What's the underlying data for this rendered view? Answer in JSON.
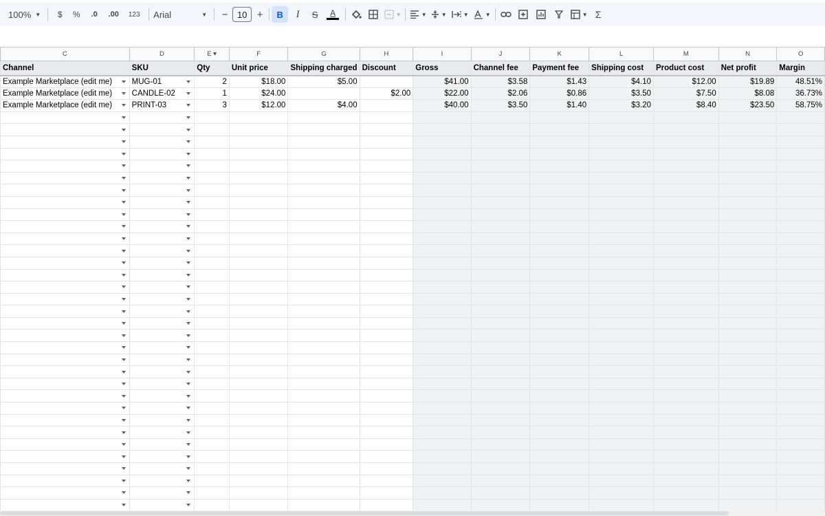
{
  "toolbar": {
    "zoom": "100%",
    "currency": "$",
    "percent": "%",
    "decrease_decimal": ".0",
    "increase_decimal": ".00",
    "number_format": "123",
    "font": "Arial",
    "minus": "−",
    "font_size": "10",
    "plus": "+",
    "bold": "B",
    "italic": "I",
    "strike": "S",
    "text_color": "A",
    "functions": "Σ"
  },
  "columns": [
    "C",
    "D",
    "E",
    "F",
    "G",
    "H",
    "I",
    "J",
    "K",
    "L",
    "M",
    "N",
    "O"
  ],
  "headers": [
    "Channel",
    "SKU",
    "Qty",
    "Unit price",
    "Shipping charged",
    "Discount",
    "Gross",
    "Channel fee",
    "Payment fee",
    "Shipping cost",
    "Product cost",
    "Net profit",
    "Margin"
  ],
  "rows": [
    [
      "Example Marketplace (edit me)",
      "MUG-01",
      "2",
      "$18.00",
      "$5.00",
      "",
      "$41.00",
      "$3.58",
      "$1.43",
      "$4.10",
      "$12.00",
      "$19.89",
      "48.51%"
    ],
    [
      "Example Marketplace (edit me)",
      "CANDLE-02",
      "1",
      "$24.00",
      "",
      "$2.00",
      "$22.00",
      "$2.06",
      "$0.86",
      "$3.50",
      "$7.50",
      "$8.08",
      "36.73%"
    ],
    [
      "Example Marketplace (edit me)",
      "PRINT-03",
      "3",
      "$12.00",
      "$4.00",
      "",
      "$40.00",
      "$3.50",
      "$1.40",
      "$3.20",
      "$8.40",
      "$23.50",
      "58.75%"
    ]
  ],
  "empty_rows": 33,
  "colors": {
    "toolbar_bg": "#f3f6fb",
    "header_row_bg": "#e8eaed",
    "calc_cell_bg": "#f1f3f4",
    "accent": "#0b57d0"
  }
}
